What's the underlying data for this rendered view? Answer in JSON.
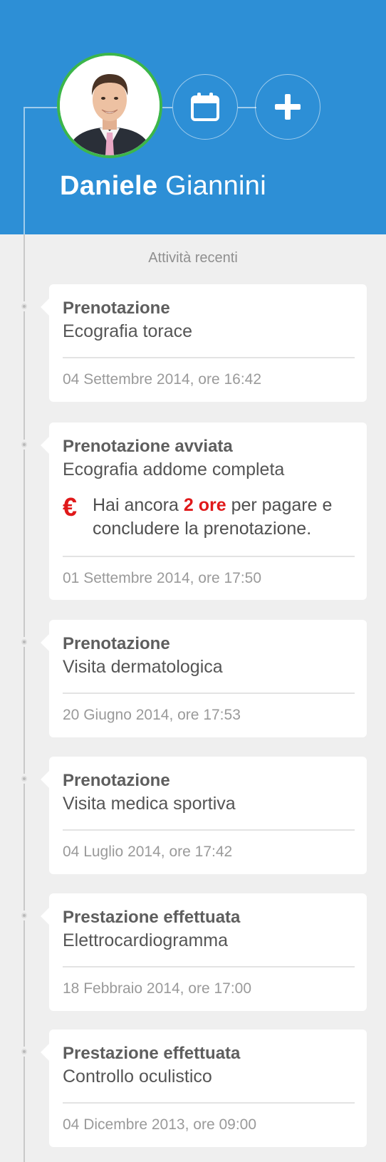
{
  "user": {
    "first_name": "Daniele",
    "last_name": "Giannini"
  },
  "header_actions": [
    {
      "icon": "calendar-icon"
    },
    {
      "icon": "plus-icon"
    }
  ],
  "section_title": "Attività recenti",
  "colors": {
    "header_bg": "#2d8fd6",
    "avatar_ring": "#3cb64a",
    "alert": "#e0191a"
  },
  "activities": [
    {
      "title": "Prenotazione",
      "subtitle": "Ecografia torace",
      "date": "04 Settembre 2014, ore 16:42"
    },
    {
      "title": "Prenotazione avviata",
      "subtitle": "Ecografia addome completa",
      "notice": {
        "icon": "euro-icon",
        "symbol": "€",
        "before": "Hai ancora ",
        "highlight": "2 ore",
        "after": " per pagare e concludere la prenotazione."
      },
      "date": "01 Settembre 2014, ore 17:50"
    },
    {
      "title": "Prenotazione",
      "subtitle": "Visita dermatologica",
      "date": "20 Giugno 2014, ore 17:53"
    },
    {
      "title": "Prenotazione",
      "subtitle": "Visita medica sportiva",
      "date": "04 Luglio 2014, ore 17:42"
    },
    {
      "title": "Prestazione effettuata",
      "subtitle": "Elettrocardiogramma",
      "date": "18 Febbraio 2014, ore 17:00"
    },
    {
      "title": "Prestazione effettuata",
      "subtitle": "Controllo oculistico",
      "date": "04 Dicembre 2013, ore 09:00"
    }
  ]
}
